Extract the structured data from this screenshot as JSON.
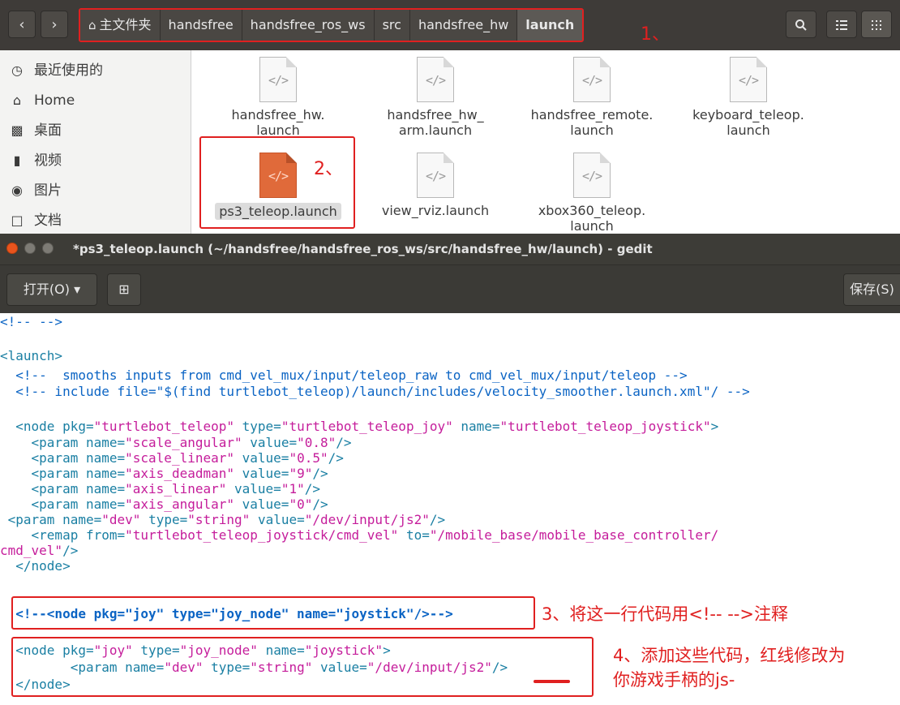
{
  "file_manager": {
    "breadcrumbs": [
      "主文件夹",
      "handsfree",
      "handsfree_ros_ws",
      "src",
      "handsfree_hw",
      "launch"
    ],
    "sidebar": [
      {
        "label": "最近使用的",
        "icon": "clock-icon"
      },
      {
        "label": "Home",
        "icon": "home-icon"
      },
      {
        "label": "桌面",
        "icon": "folder-icon"
      },
      {
        "label": "视频",
        "icon": "video-icon"
      },
      {
        "label": "图片",
        "icon": "camera-icon"
      },
      {
        "label": "文档",
        "icon": "document-icon"
      }
    ],
    "files": [
      {
        "line1": "handsfree_hw.",
        "line2": "launch"
      },
      {
        "line1": "handsfree_hw_",
        "line2": "arm.launch"
      },
      {
        "line1": "handsfree_remote.",
        "line2": "launch"
      },
      {
        "line1": "keyboard_teleop.",
        "line2": "launch"
      },
      {
        "line1": "ps3_teleop.launch",
        "line2": ""
      },
      {
        "line1": "view_rviz.launch",
        "line2": ""
      },
      {
        "line1": "xbox360_teleop.",
        "line2": "launch"
      }
    ],
    "file_icon_glyph": "</>"
  },
  "annotations": {
    "a1": "1、",
    "a2": "2、",
    "a3": "3、将这一行代码用<!-- -->注释",
    "a4_line1": "4、添加这些代码，红线修改为",
    "a4_line2": "你游戏手柄的js-"
  },
  "gedit": {
    "title": "*ps3_teleop.launch (~/handsfree/handsfree_ros_ws/src/handsfree_hw/launch) - gedit",
    "open_label": "打开(O)",
    "open_arrow": "▾",
    "new_tab_glyph": "⊞",
    "save_label": "保存(S)"
  },
  "colors": {
    "accent_red": "#e02020",
    "selected_file_icon": "#e06a3a",
    "dark_chrome": "#3d3c37"
  }
}
